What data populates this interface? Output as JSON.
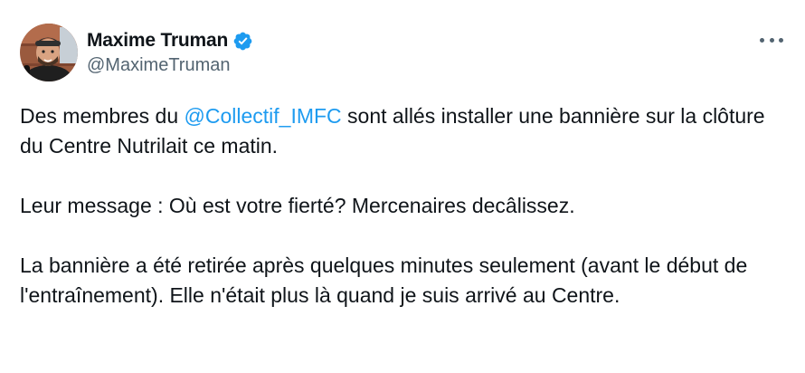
{
  "author": {
    "display_name": "Maxime Truman",
    "handle": "@MaximeTruman",
    "verified": true,
    "verified_color": "#1d9bf0"
  },
  "menu": {
    "icon": "more-horizontal-icon"
  },
  "tweet": {
    "paragraphs": [
      {
        "before_mention": "Des membres du ",
        "mention": "@Collectif_IMFC",
        "after_mention": " sont allés installer une bannière sur la clôture du Centre Nutrilait ce matin."
      },
      {
        "text": "Leur message : Où est votre fierté? Mercenaires decâlissez."
      },
      {
        "text": "La bannière a été retirée après quelques minutes seulement (avant le début de l'entraînement). Elle n'était plus là quand je suis arrivé au Centre."
      }
    ],
    "mention_color": "#1d9bf0"
  }
}
